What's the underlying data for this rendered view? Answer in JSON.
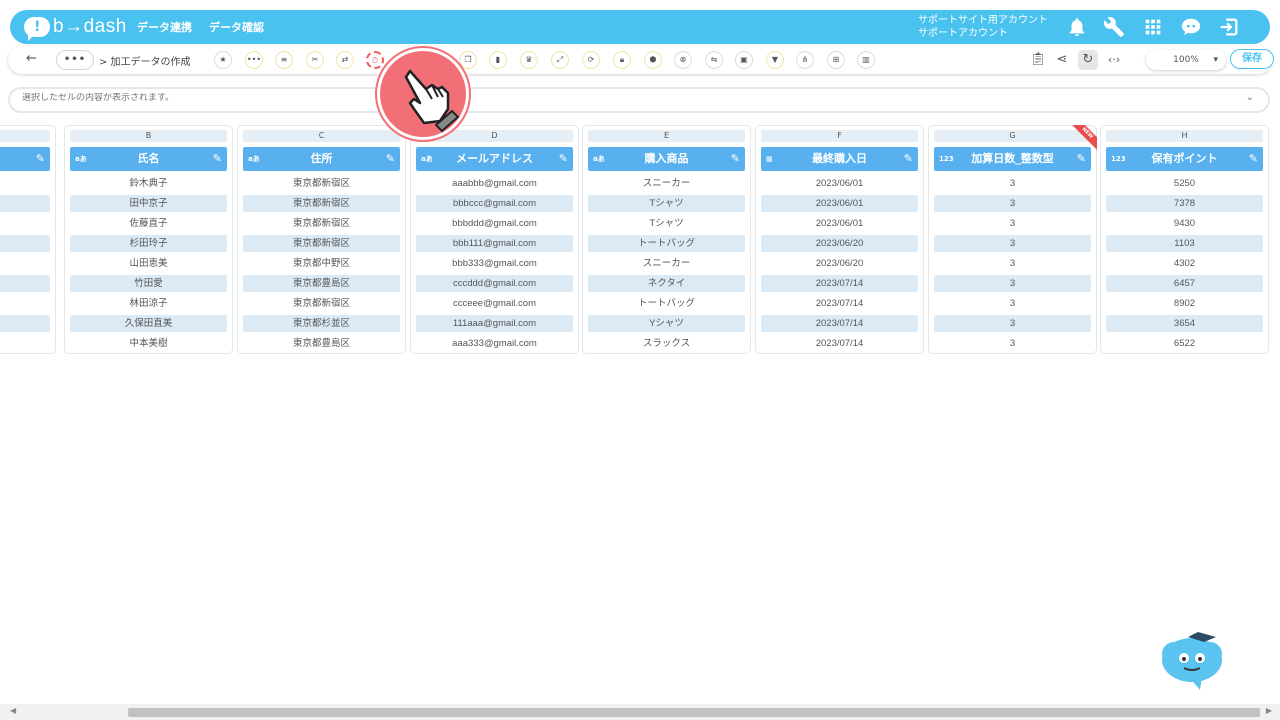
{
  "header": {
    "logo_mark": "!",
    "logo_text": "b→dash",
    "nav": [
      "データ連携",
      "データ確認"
    ],
    "account_line1": "サポートサイト用アカウント",
    "account_line2": "サポートアカウント",
    "icons": [
      "bell-icon",
      "wrench-icon",
      "apps-grid-icon",
      "help-chat-icon",
      "logout-icon"
    ]
  },
  "toolbar": {
    "back": "←",
    "more": "•••",
    "breadcrumb": "> 加工データの作成",
    "zoom": "100%",
    "save_label": "保存"
  },
  "cellbar": {
    "placeholder": "選択したセルの内容が表示されます。"
  },
  "table": {
    "columns": [
      {
        "letter": "B",
        "type": "aあ",
        "name": "氏名",
        "values": [
          "鈴木典子",
          "田中京子",
          "佐藤直子",
          "杉田玲子",
          "山田恵美",
          "竹田愛",
          "林田涼子",
          "久保田直美",
          "中本美樹"
        ]
      },
      {
        "letter": "C",
        "type": "aあ",
        "name": "住所",
        "values": [
          "東京都新宿区",
          "東京都新宿区",
          "東京都新宿区",
          "東京都新宿区",
          "東京都中野区",
          "東京都豊島区",
          "東京都新宿区",
          "東京都杉並区",
          "東京都豊島区"
        ]
      },
      {
        "letter": "D",
        "type": "aあ",
        "name": "メールアドレス",
        "values": [
          "aaabbb@gmail.com",
          "bbbccc@gmail.com",
          "bbbddd@gmail.com",
          "bbb111@gmail.com",
          "bbb333@gmail.com",
          "cccddd@gmail.com",
          "ccceee@gmail.com",
          "111aaa@gmail.com",
          "aaa333@gmail.com"
        ]
      },
      {
        "letter": "E",
        "type": "aあ",
        "name": "購入商品",
        "values": [
          "スニーカー",
          "Tシャツ",
          "Tシャツ",
          "トートバッグ",
          "スニーカー",
          "ネクタイ",
          "トートバッグ",
          "Yシャツ",
          "スラックス"
        ]
      },
      {
        "letter": "F",
        "type": "date",
        "name": "最終購入日",
        "values": [
          "2023/06/01",
          "2023/06/01",
          "2023/06/01",
          "2023/06/20",
          "2023/06/20",
          "2023/07/14",
          "2023/07/14",
          "2023/07/14",
          "2023/07/14"
        ]
      },
      {
        "letter": "G",
        "type": "123",
        "name": "加算日数_整数型",
        "badge": "NEW",
        "values": [
          "3",
          "3",
          "3",
          "3",
          "3",
          "3",
          "3",
          "3",
          "3"
        ]
      },
      {
        "letter": "H",
        "type": "123",
        "name": "保有ポイント",
        "values": [
          "5250",
          "7378",
          "9430",
          "1103",
          "4302",
          "6457",
          "8902",
          "3654",
          "6522"
        ]
      }
    ]
  },
  "colors": {
    "brand": "#49c2f0",
    "column_header": "#58b1ee",
    "alt_row": "#dceaf6",
    "highlight": "#f36f77"
  }
}
